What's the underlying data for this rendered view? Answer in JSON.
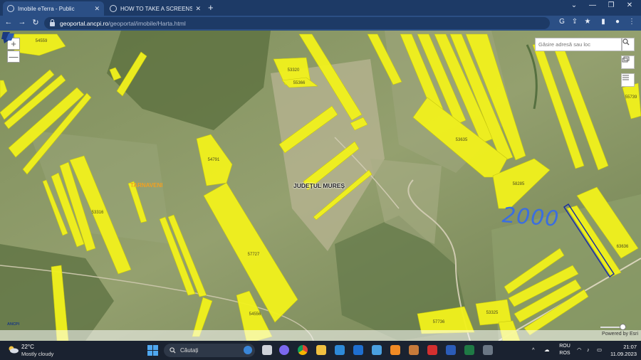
{
  "browser": {
    "tabs": [
      {
        "title": "Imobile eTerra - Public",
        "active": true
      },
      {
        "title": "HOW TO TAKE A SCREENSHOT O",
        "active": false
      }
    ],
    "new_tab_label": "+",
    "url_host": "geoportal.ancpi.ro",
    "url_path": "/geoportal/imobile/Harta.html",
    "nav": {
      "back": "←",
      "forward": "→",
      "reload": "↻"
    },
    "window_controls": {
      "chevron": "⌄",
      "minimize": "—",
      "restore": "❐",
      "close": "✕"
    },
    "toolbar_icons": [
      "google-icon",
      "share-icon",
      "star-icon",
      "sidebar-icon",
      "profile-icon",
      "kebab-menu-icon"
    ]
  },
  "map": {
    "zoom_in": "+",
    "zoom_out": "—",
    "search_placeholder": "Găsire adresă sau loc",
    "parcel_fill": "#f2f21c",
    "parcel_labels": [
      "54559",
      "53320",
      "55366",
      "55739",
      "53635",
      "54791",
      "53316",
      "58285",
      "63636",
      "57727",
      "54556",
      "53325",
      "57736"
    ],
    "places": {
      "town": "TARNAVENI",
      "county": "JUDEȚUL MUREȘ"
    },
    "annotation": "2000",
    "logo_text": "ANCPI",
    "attribution": "Powered by Esri"
  },
  "taskbar": {
    "weather_temp": "22°C",
    "weather_desc": "Mostly cloudy",
    "search_label": "Căutați",
    "lang_line1": "ROU",
    "lang_line2": "ROS",
    "time": "21:07",
    "date": "11.09.2023",
    "app_icons": [
      "file-explorer-icon",
      "chat-icon",
      "chrome-icon",
      "folder-icon",
      "mail-icon",
      "store-icon",
      "monitor-icon",
      "vlc-icon",
      "paint-icon",
      "pdf-icon",
      "word-icon",
      "excel-icon",
      "calculator-icon"
    ]
  }
}
